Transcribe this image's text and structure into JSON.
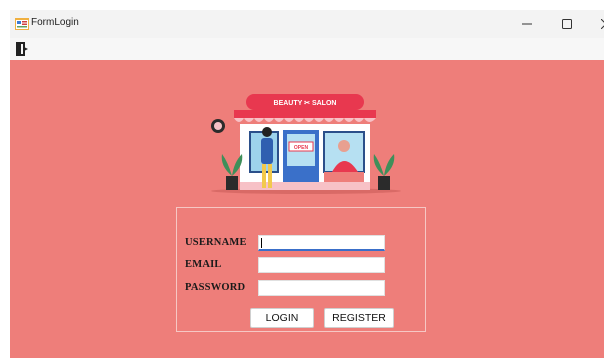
{
  "window": {
    "title": "FormLogin",
    "controls": {
      "minimize": "minimize-icon",
      "maximize": "maximize-icon",
      "close": "close-icon"
    }
  },
  "toolbar": {
    "exit_icon": "exit-door-icon"
  },
  "illustration": {
    "sign_text": "BEAUTY ✂ SALON",
    "door_sign": "OPEN"
  },
  "form": {
    "username_label": "USERNAME",
    "email_label": "EMAIL",
    "password_label": "PASSWORD",
    "username_value": "",
    "email_value": "",
    "password_value": "",
    "login_button": "LOGIN",
    "register_button": "REGISTER"
  },
  "colors": {
    "background": "#ee7e7a",
    "awning_red": "#e8384f",
    "field_focus": "#3a6fc9"
  }
}
